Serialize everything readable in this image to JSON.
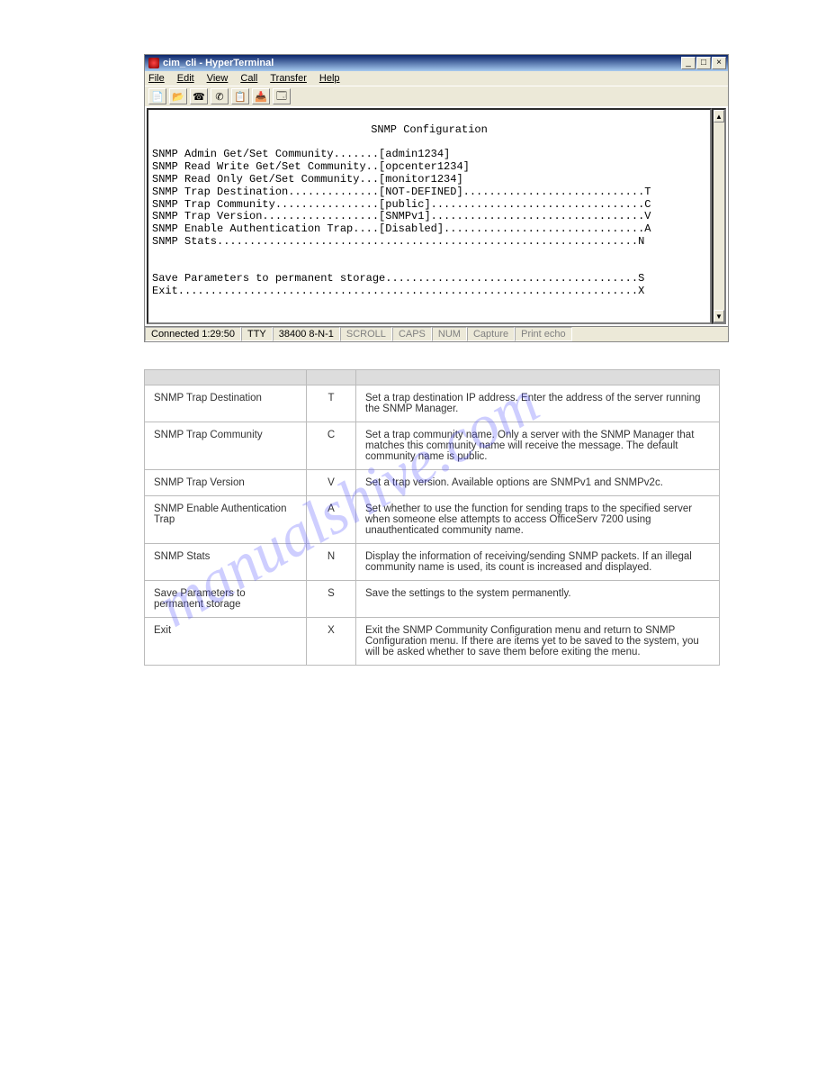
{
  "watermark": "manualshive.com",
  "win": {
    "title": "cim_cli - HyperTerminal",
    "menu": {
      "file": "File",
      "edit": "Edit",
      "view": "View",
      "call": "Call",
      "transfer": "Transfer",
      "help": "Help"
    },
    "term": {
      "title": "SNMP Configuration",
      "lines": [
        "SNMP Admin Get/Set Community.......[admin1234]",
        "SNMP Read Write Get/Set Community..[opcenter1234]",
        "SNMP Read Only Get/Set Community...[monitor1234]",
        "SNMP Trap Destination..............[NOT-DEFINED]............................T",
        "SNMP Trap Community................[public].................................C",
        "SNMP Trap Version..................[SNMPv1].................................V",
        "SNMP Enable Authentication Trap....[Disabled]...............................A",
        "SNMP Stats.................................................................N",
        "",
        "",
        "Save Parameters to permanent storage.......................................S",
        "Exit.......................................................................X"
      ]
    },
    "status": {
      "connected": "Connected 1:29:50",
      "port": "TTY",
      "rate": "38400 8-N-1",
      "scroll": "SCROLL",
      "caps": "CAPS",
      "num": "NUM",
      "capture": "Capture",
      "echo": "Print echo"
    }
  },
  "table": {
    "head": {
      "c1": "",
      "c2": "",
      "c3": ""
    },
    "rows": [
      {
        "name": "SNMP Trap Destination",
        "key": "T",
        "desc": "Set a trap destination IP address. Enter the address of the server running the SNMP Manager."
      },
      {
        "name": "SNMP Trap Community",
        "key": "C",
        "desc": "Set a trap community name. Only a server with the SNMP Manager that matches this community name will receive the message. The default community name is public."
      },
      {
        "name": "SNMP Trap Version",
        "key": "V",
        "desc": "Set a trap version. Available options are SNMPv1 and SNMPv2c."
      },
      {
        "name": "SNMP Enable Authentication Trap",
        "key": "A",
        "desc": "Set whether to use the function for sending traps to the specified server when someone else attempts to access OfficeServ 7200 using unauthenticated community name."
      },
      {
        "name": "SNMP Stats",
        "key": "N",
        "desc": "Display the information of receiving/sending SNMP packets. If an illegal community name is used, its count is increased and displayed."
      },
      {
        "name": "Save Parameters to permanent storage",
        "key": "S",
        "desc": "Save the settings to the system permanently."
      },
      {
        "name": "Exit",
        "key": "X",
        "desc": "Exit the SNMP Community Configuration menu and return to SNMP Configuration menu. If there are items yet to be saved to the system, you will be asked whether to save them before exiting the menu."
      }
    ]
  }
}
